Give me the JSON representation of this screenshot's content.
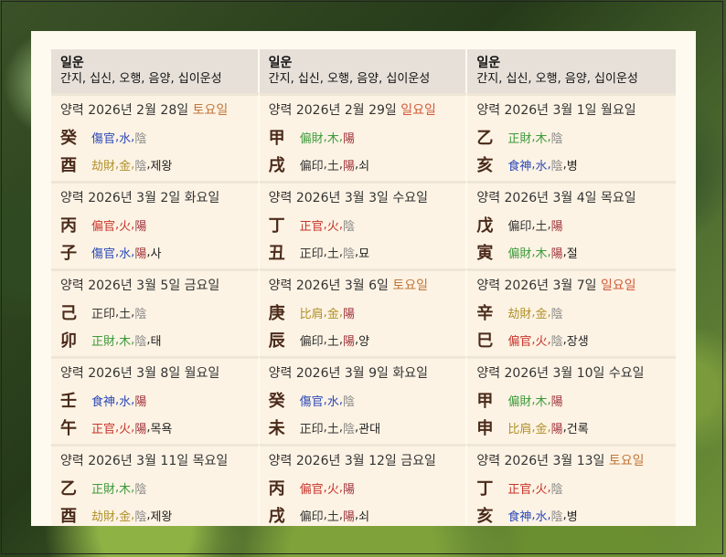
{
  "header": {
    "columns": [
      {
        "title": "일운",
        "subtitle": "간지, 십신, 오행, 음양, 십이운성"
      },
      {
        "title": "일운",
        "subtitle": "간지, 십신, 오행, 음양, 십이운성"
      },
      {
        "title": "일운",
        "subtitle": "간지, 십신, 오행, 음양, 십이운성"
      }
    ]
  },
  "rows": [
    [
      {
        "date": "양력 2026년 2월 28일",
        "weekday": "토요일",
        "wk": "sat",
        "stem": {
          "char": "癸",
          "god": "傷官",
          "el": "水",
          "yy": "陰",
          "elc": "water",
          "yyc": "yin"
        },
        "branch": {
          "char": "酉",
          "god": "劫財",
          "el": "金",
          "yy": "陰",
          "elc": "metal",
          "yyc": "yin",
          "stage": "제왕"
        }
      },
      {
        "date": "양력 2026년 2월 29일",
        "weekday": "일요일",
        "wk": "sun",
        "stem": {
          "char": "甲",
          "god": "偏財",
          "el": "木",
          "yy": "陽",
          "elc": "wood",
          "yyc": "yang"
        },
        "branch": {
          "char": "戌",
          "god": "偏印",
          "el": "土",
          "yy": "陽",
          "elc": "earth",
          "yyc": "yang",
          "stage": "쇠"
        }
      },
      {
        "date": "양력 2026년 3월 1일",
        "weekday": "월요일",
        "wk": "",
        "stem": {
          "char": "乙",
          "god": "正財",
          "el": "木",
          "yy": "陰",
          "elc": "wood",
          "yyc": "yin"
        },
        "branch": {
          "char": "亥",
          "god": "食神",
          "el": "水",
          "yy": "陰",
          "elc": "water",
          "yyc": "yin",
          "stage": "병"
        }
      }
    ],
    [
      {
        "date": "양력 2026년 3월 2일",
        "weekday": "화요일",
        "wk": "",
        "stem": {
          "char": "丙",
          "god": "偏官",
          "el": "火",
          "yy": "陽",
          "elc": "fire",
          "yyc": "yang"
        },
        "branch": {
          "char": "子",
          "god": "傷官",
          "el": "水",
          "yy": "陽",
          "elc": "water",
          "yyc": "yang",
          "stage": "사"
        }
      },
      {
        "date": "양력 2026년 3월 3일",
        "weekday": "수요일",
        "wk": "",
        "stem": {
          "char": "丁",
          "god": "正官",
          "el": "火",
          "yy": "陰",
          "elc": "fire",
          "yyc": "yin"
        },
        "branch": {
          "char": "丑",
          "god": "正印",
          "el": "土",
          "yy": "陰",
          "elc": "earth",
          "yyc": "yin",
          "stage": "묘"
        }
      },
      {
        "date": "양력 2026년 3월 4일",
        "weekday": "목요일",
        "wk": "",
        "stem": {
          "char": "戊",
          "god": "偏印",
          "el": "土",
          "yy": "陽",
          "elc": "earth",
          "yyc": "yang"
        },
        "branch": {
          "char": "寅",
          "god": "偏財",
          "el": "木",
          "yy": "陽",
          "elc": "wood",
          "yyc": "yang",
          "stage": "절"
        }
      }
    ],
    [
      {
        "date": "양력 2026년 3월 5일",
        "weekday": "금요일",
        "wk": "",
        "stem": {
          "char": "己",
          "god": "正印",
          "el": "土",
          "yy": "陰",
          "elc": "earth",
          "yyc": "yin"
        },
        "branch": {
          "char": "卯",
          "god": "正財",
          "el": "木",
          "yy": "陰",
          "elc": "wood",
          "yyc": "yin",
          "stage": "태"
        }
      },
      {
        "date": "양력 2026년 3월 6일",
        "weekday": "토요일",
        "wk": "sat",
        "stem": {
          "char": "庚",
          "god": "比肩",
          "el": "金",
          "yy": "陽",
          "elc": "metal",
          "yyc": "yang"
        },
        "branch": {
          "char": "辰",
          "god": "偏印",
          "el": "土",
          "yy": "陽",
          "elc": "earth",
          "yyc": "yang",
          "stage": "양"
        }
      },
      {
        "date": "양력 2026년 3월 7일",
        "weekday": "일요일",
        "wk": "sun",
        "stem": {
          "char": "辛",
          "god": "劫財",
          "el": "金",
          "yy": "陰",
          "elc": "metal",
          "yyc": "yin"
        },
        "branch": {
          "char": "巳",
          "god": "偏官",
          "el": "火",
          "yy": "陰",
          "elc": "fire",
          "yyc": "yin",
          "stage": "장생"
        }
      }
    ],
    [
      {
        "date": "양력 2026년 3월 8일",
        "weekday": "월요일",
        "wk": "",
        "stem": {
          "char": "壬",
          "god": "食神",
          "el": "水",
          "yy": "陽",
          "elc": "water",
          "yyc": "yang"
        },
        "branch": {
          "char": "午",
          "god": "正官",
          "el": "火",
          "yy": "陽",
          "elc": "fire",
          "yyc": "yang",
          "stage": "목욕"
        }
      },
      {
        "date": "양력 2026년 3월 9일",
        "weekday": "화요일",
        "wk": "",
        "stem": {
          "char": "癸",
          "god": "傷官",
          "el": "水",
          "yy": "陰",
          "elc": "water",
          "yyc": "yin"
        },
        "branch": {
          "char": "未",
          "god": "正印",
          "el": "土",
          "yy": "陰",
          "elc": "earth",
          "yyc": "yin",
          "stage": "관대"
        }
      },
      {
        "date": "양력 2026년 3월 10일",
        "weekday": "수요일",
        "wk": "",
        "stem": {
          "char": "甲",
          "god": "偏財",
          "el": "木",
          "yy": "陽",
          "elc": "wood",
          "yyc": "yang"
        },
        "branch": {
          "char": "申",
          "god": "比肩",
          "el": "金",
          "yy": "陽",
          "elc": "metal",
          "yyc": "yang",
          "stage": "건록"
        }
      }
    ],
    [
      {
        "date": "양력 2026년 3월 11일",
        "weekday": "목요일",
        "wk": "",
        "stem": {
          "char": "乙",
          "god": "正財",
          "el": "木",
          "yy": "陰",
          "elc": "wood",
          "yyc": "yin"
        },
        "branch": {
          "char": "酉",
          "god": "劫財",
          "el": "金",
          "yy": "陰",
          "elc": "metal",
          "yyc": "yin",
          "stage": "제왕"
        }
      },
      {
        "date": "양력 2026년 3월 12일",
        "weekday": "금요일",
        "wk": "",
        "stem": {
          "char": "丙",
          "god": "偏官",
          "el": "火",
          "yy": "陽",
          "elc": "fire",
          "yyc": "yang"
        },
        "branch": {
          "char": "戌",
          "god": "偏印",
          "el": "土",
          "yy": "陽",
          "elc": "earth",
          "yyc": "yang",
          "stage": "쇠"
        }
      },
      {
        "date": "양력 2026년 3월 13일",
        "weekday": "토요일",
        "wk": "sat",
        "stem": {
          "char": "丁",
          "god": "正官",
          "el": "火",
          "yy": "陰",
          "elc": "fire",
          "yyc": "yin"
        },
        "branch": {
          "char": "亥",
          "god": "食神",
          "el": "水",
          "yy": "陰",
          "elc": "water",
          "yyc": "yin",
          "stage": "병"
        }
      }
    ]
  ]
}
